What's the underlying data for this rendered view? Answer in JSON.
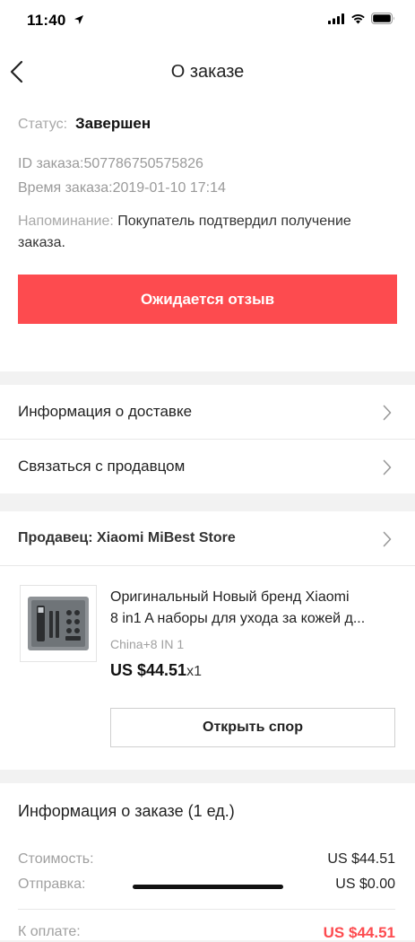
{
  "status_bar": {
    "time": "11:40",
    "icons": [
      "location-arrow-icon",
      "signal-icon",
      "wifi-icon",
      "battery-icon"
    ]
  },
  "nav": {
    "title": "О заказе",
    "back_icon": "chevron-left-icon"
  },
  "order_status": {
    "status_label": "Статус:",
    "status_value": "Завершен",
    "id_label": "ID заказа:",
    "id_value": "507786750575826",
    "time_label": "Время заказа:",
    "time_value": "2019-01-10 17:14",
    "reminder_label": "Напоминание:",
    "reminder_text": "Покупатель подтвердил получение заказа.",
    "review_button": "Ожидается отзыв",
    "accent_color": "#fd4b4f"
  },
  "links": {
    "delivery_info": "Информация о доставке",
    "contact_seller": "Связаться с продавцом"
  },
  "seller": {
    "label": "Продавец: Xiaomi MiBest Store"
  },
  "product": {
    "title_line1": "Оригинальный Новый бренд Xiaomi",
    "title_line2": "8 in1 A наборы для ухода за кожей д...",
    "variant": "China+8 IN 1",
    "price": "US $44.51",
    "quantity": "x1",
    "dispute_button": "Открыть спор"
  },
  "order_info": {
    "title": "Информация о заказе (1 ед.)",
    "cost_label": "Стоимость:",
    "cost_value": "US $44.51",
    "shipping_label": "Отправка:",
    "shipping_value": "US $0.00",
    "total_label": "К оплате:",
    "total_value": "US $44.51"
  }
}
